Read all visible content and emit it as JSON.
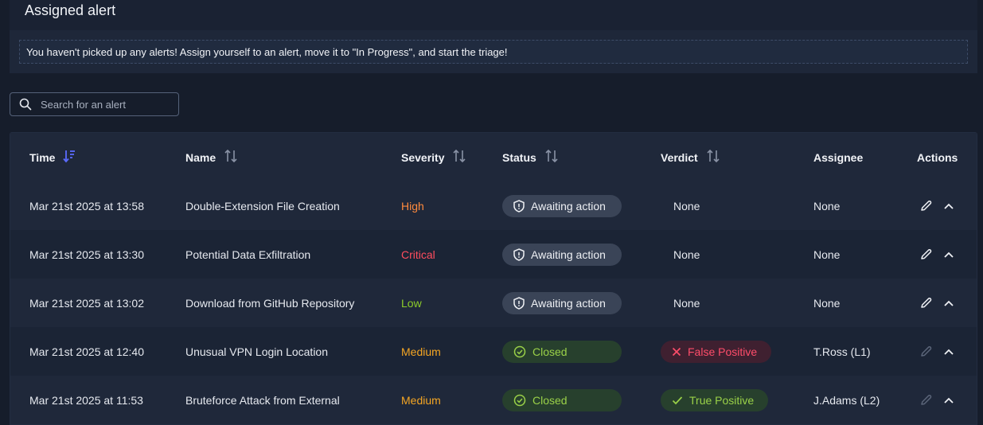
{
  "card": {
    "title": "Assigned alert",
    "notice": "You haven't picked up any alerts! Assign yourself to an alert, move it to \"In Progress\", and start the triage!"
  },
  "search": {
    "placeholder": "Search for an alert",
    "value": ""
  },
  "columns": {
    "time": "Time",
    "name": "Name",
    "severity": "Severity",
    "status": "Status",
    "verdict": "Verdict",
    "assignee": "Assignee",
    "actions": "Actions"
  },
  "colors": {
    "accent": "#5b6bff",
    "high": "#ff8a3d",
    "critical": "#ff4d5e",
    "low": "#8ccc2a",
    "medium": "#f5a623"
  },
  "rows": [
    {
      "time": "Mar 21st 2025 at 13:58",
      "name": "Double-Extension File Creation",
      "severity": "High",
      "status": "Awaiting action",
      "verdict": "None",
      "assignee": "None"
    },
    {
      "time": "Mar 21st 2025 at 13:30",
      "name": "Potential Data Exfiltration",
      "severity": "Critical",
      "status": "Awaiting action",
      "verdict": "None",
      "assignee": "None"
    },
    {
      "time": "Mar 21st 2025 at 13:02",
      "name": "Download from GitHub Repository",
      "severity": "Low",
      "status": "Awaiting action",
      "verdict": "None",
      "assignee": "None"
    },
    {
      "time": "Mar 21st 2025 at 12:40",
      "name": "Unusual VPN Login Location",
      "severity": "Medium",
      "status": "Closed",
      "verdict": "False Positive",
      "assignee": "T.Ross (L1)"
    },
    {
      "time": "Mar 21st 2025 at 11:53",
      "name": "Bruteforce Attack from External",
      "severity": "Medium",
      "status": "Closed",
      "verdict": "True Positive",
      "assignee": "J.Adams (L2)"
    }
  ]
}
